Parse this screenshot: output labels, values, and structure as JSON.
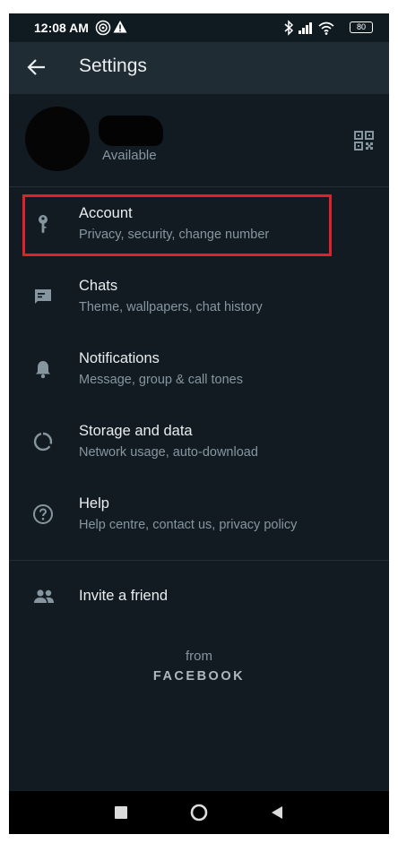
{
  "status_bar": {
    "time": "12:08 AM",
    "battery": "80"
  },
  "app_bar": {
    "title": "Settings"
  },
  "profile": {
    "status": "Available"
  },
  "menu": [
    {
      "title": "Account",
      "subtitle": "Privacy, security, change number",
      "icon": "key-icon"
    },
    {
      "title": "Chats",
      "subtitle": "Theme, wallpapers, chat history",
      "icon": "chat-icon"
    },
    {
      "title": "Notifications",
      "subtitle": "Message, group & call tones",
      "icon": "bell-icon"
    },
    {
      "title": "Storage and data",
      "subtitle": "Network usage, auto-download",
      "icon": "data-usage-icon"
    },
    {
      "title": "Help",
      "subtitle": "Help centre, contact us, privacy policy",
      "icon": "help-icon"
    }
  ],
  "invite": {
    "title": "Invite a friend",
    "icon": "people-icon"
  },
  "footer": {
    "from": "from",
    "brand": "FACEBOOK"
  },
  "colors": {
    "background": "#121b22",
    "app_bar": "#1f2c34",
    "primary_text": "#e9edef",
    "secondary_text": "#8696a0",
    "icon": "#8696a0",
    "highlight": "#e0212a"
  }
}
